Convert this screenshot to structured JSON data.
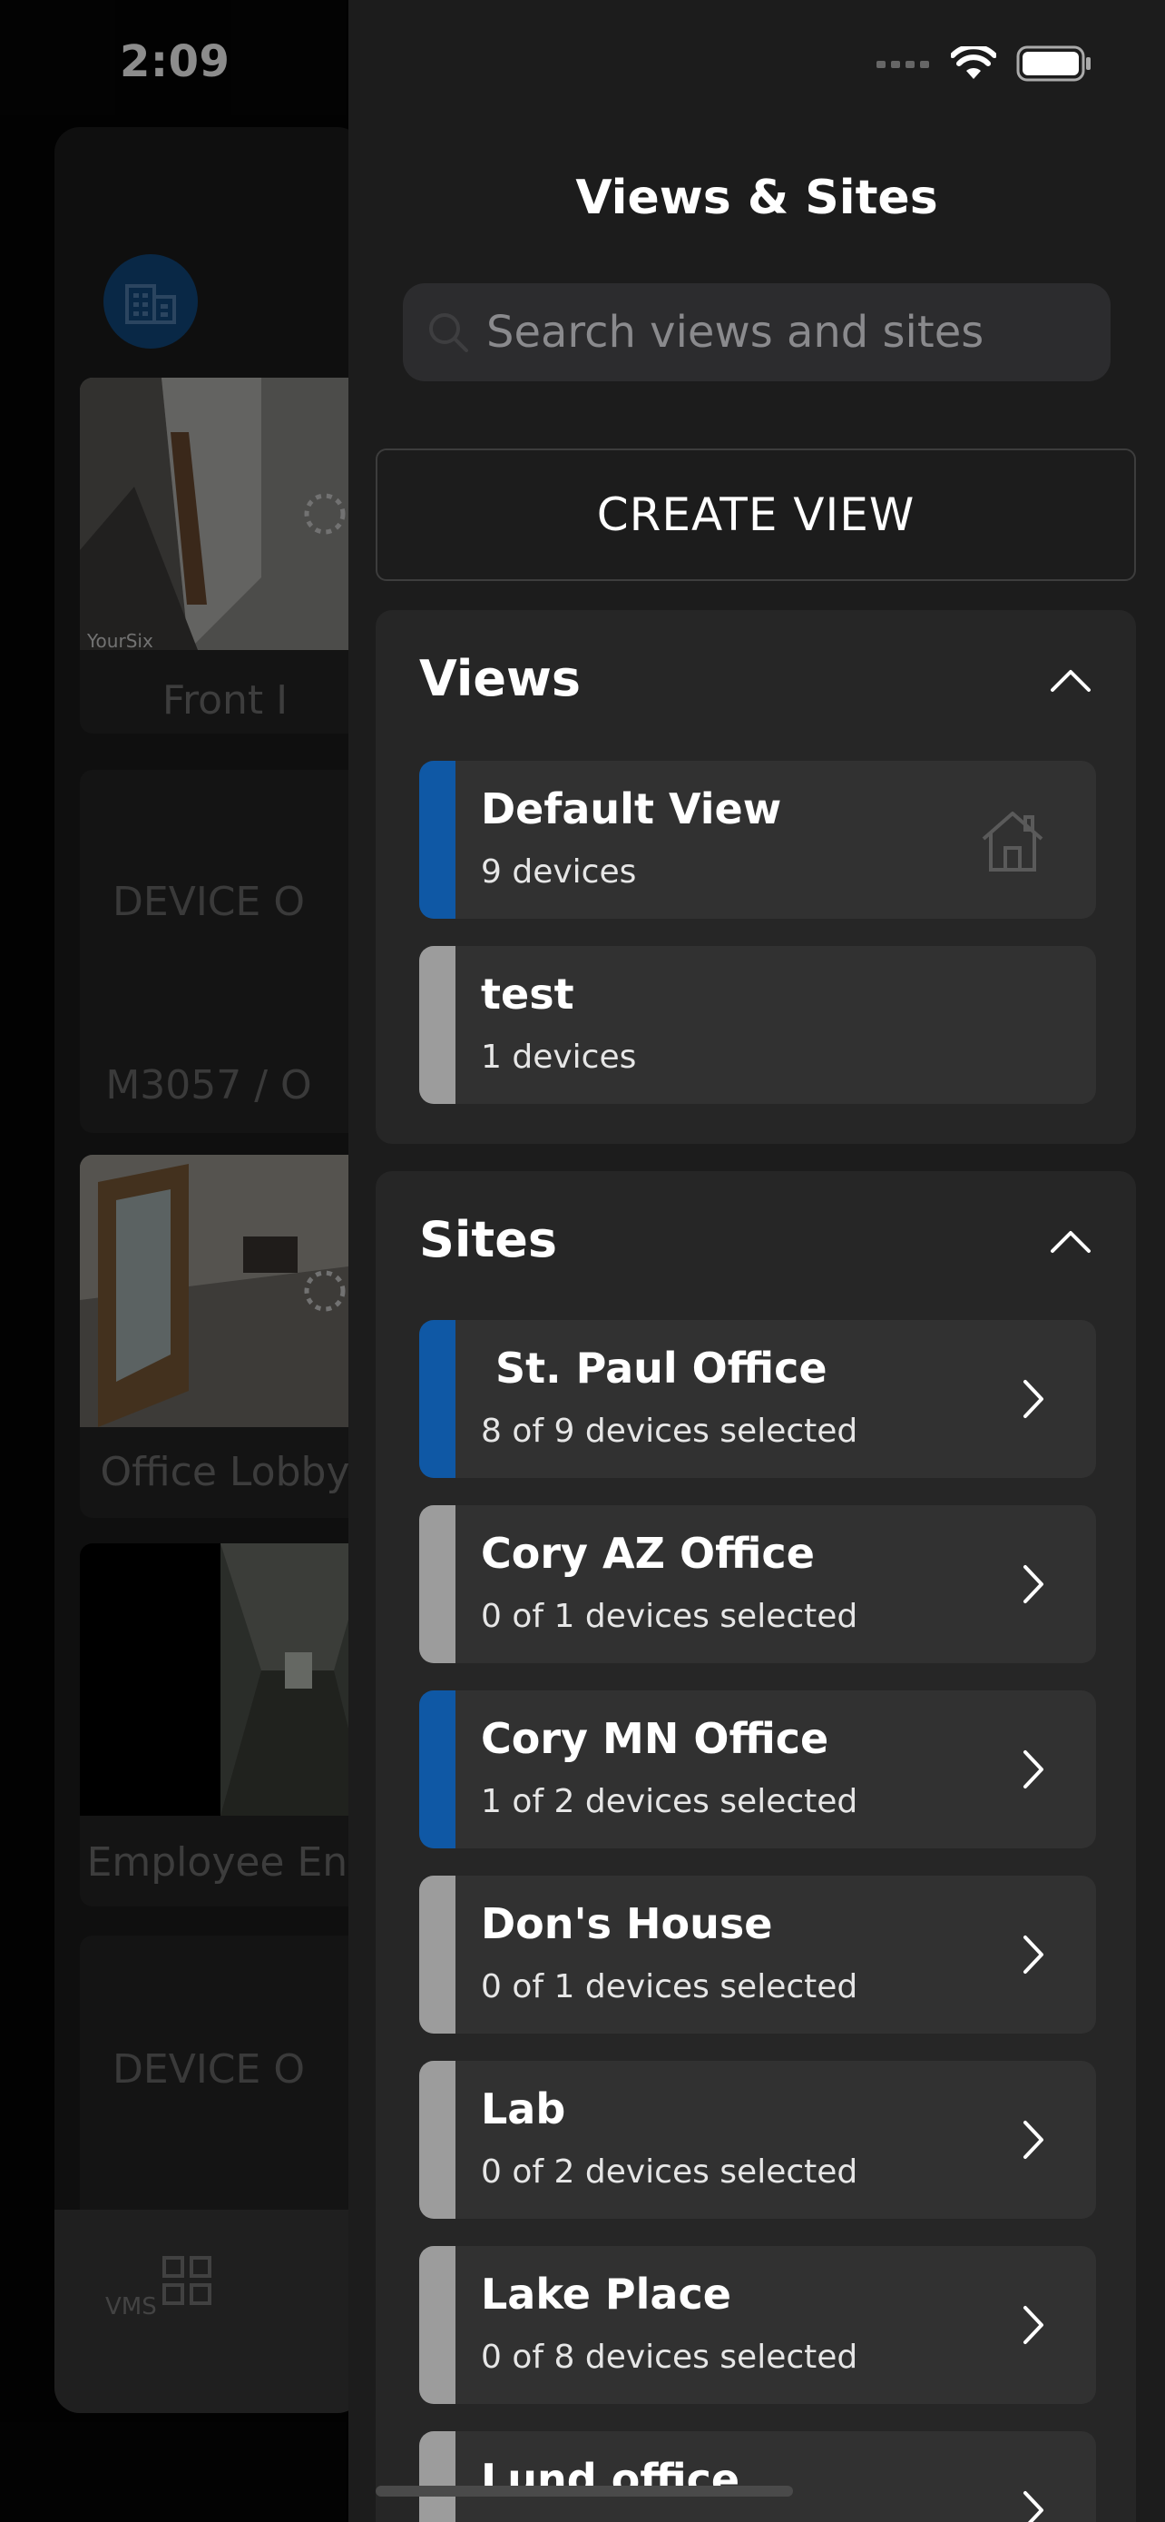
{
  "status_bar": {
    "time": "2:09"
  },
  "background": {
    "tiles": [
      {
        "label": "Front I",
        "watermark": "YourSix"
      },
      {
        "offline_text": "DEVICE O",
        "label": "M3057 / O"
      },
      {
        "label": "Office Lobby"
      },
      {
        "label": "Employee Ent"
      },
      {
        "offline_text": "DEVICE O"
      }
    ],
    "tab_label": "VMS"
  },
  "drawer": {
    "title": "Views & Sites",
    "search_placeholder": "Search views and sites",
    "create_view_label": "CREATE VIEW",
    "views": {
      "title": "Views",
      "items": [
        {
          "name": "Default View",
          "sub": "9 devices",
          "selected": true,
          "home": true
        },
        {
          "name": "test",
          "sub": "1 devices",
          "selected": false,
          "home": false
        }
      ]
    },
    "sites": {
      "title": "Sites",
      "items": [
        {
          "name": " St. Paul Office",
          "sub": "8 of 9 devices selected",
          "selected": true
        },
        {
          "name": "Cory AZ Office",
          "sub": "0 of 1 devices selected",
          "selected": false
        },
        {
          "name": "Cory MN Office",
          "sub": "1 of 2 devices selected",
          "selected": true
        },
        {
          "name": "Don's House",
          "sub": "0 of 1 devices selected",
          "selected": false
        },
        {
          "name": "Lab",
          "sub": "0 of 2 devices selected",
          "selected": false
        },
        {
          "name": "Lake Place",
          "sub": "0 of 8 devices selected",
          "selected": false
        },
        {
          "name": "Lund office",
          "sub": "",
          "selected": false
        }
      ]
    }
  },
  "colors": {
    "accent": "#0f58a5",
    "unselected": "#9c9c9c",
    "drawer_bg": "#1c1c1c"
  }
}
